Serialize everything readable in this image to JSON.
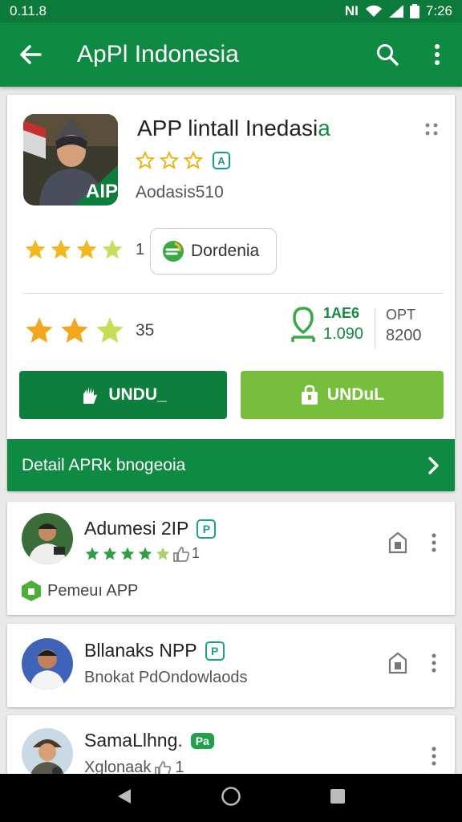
{
  "status_bar": {
    "time": "0.11.8",
    "clock": "7:26",
    "network": "NI"
  },
  "app_bar": {
    "title": "ApPl Indonesia"
  },
  "app": {
    "title_main": "APP lintall Inedasi",
    "title_accent": "a",
    "icon_text": "AIP",
    "developer": "Aodasis510",
    "rating_a_count": "1",
    "category_label": "Dordenia",
    "rating_b_count": "35",
    "stat1_label": "1AE6",
    "stat1_value": "1.090",
    "stat2_label": "OPT",
    "stat2_value": "8200",
    "install_label": "UNDU_",
    "open_label": "UNDuL",
    "detail_label": "Detail APRk bnogeoia"
  },
  "list": [
    {
      "title": "Adumesi 2IP",
      "badge": "P",
      "rating_count": "1",
      "promo": "Pemeuı APP"
    },
    {
      "title": "Bllanaks NPP",
      "badge": "P",
      "subtitle": "Bnokat PdOndowlaods"
    },
    {
      "title": "SamaLlhng.",
      "badge": "Pa",
      "subtitle": "Xglonaak",
      "rating_count": "1"
    }
  ],
  "colors": {
    "primary": "#0f8a42",
    "accent_light": "#77be3c",
    "star": "#f2b824",
    "teal_badge": "#1aa08e"
  },
  "icons": [
    "back-arrow-icon",
    "search-icon",
    "more-vert-icon",
    "star-icon",
    "thumbs-up-icon",
    "install-icon",
    "hand-icon",
    "shopping-bag-icon",
    "bookmark-icon",
    "chevron-right-icon"
  ]
}
